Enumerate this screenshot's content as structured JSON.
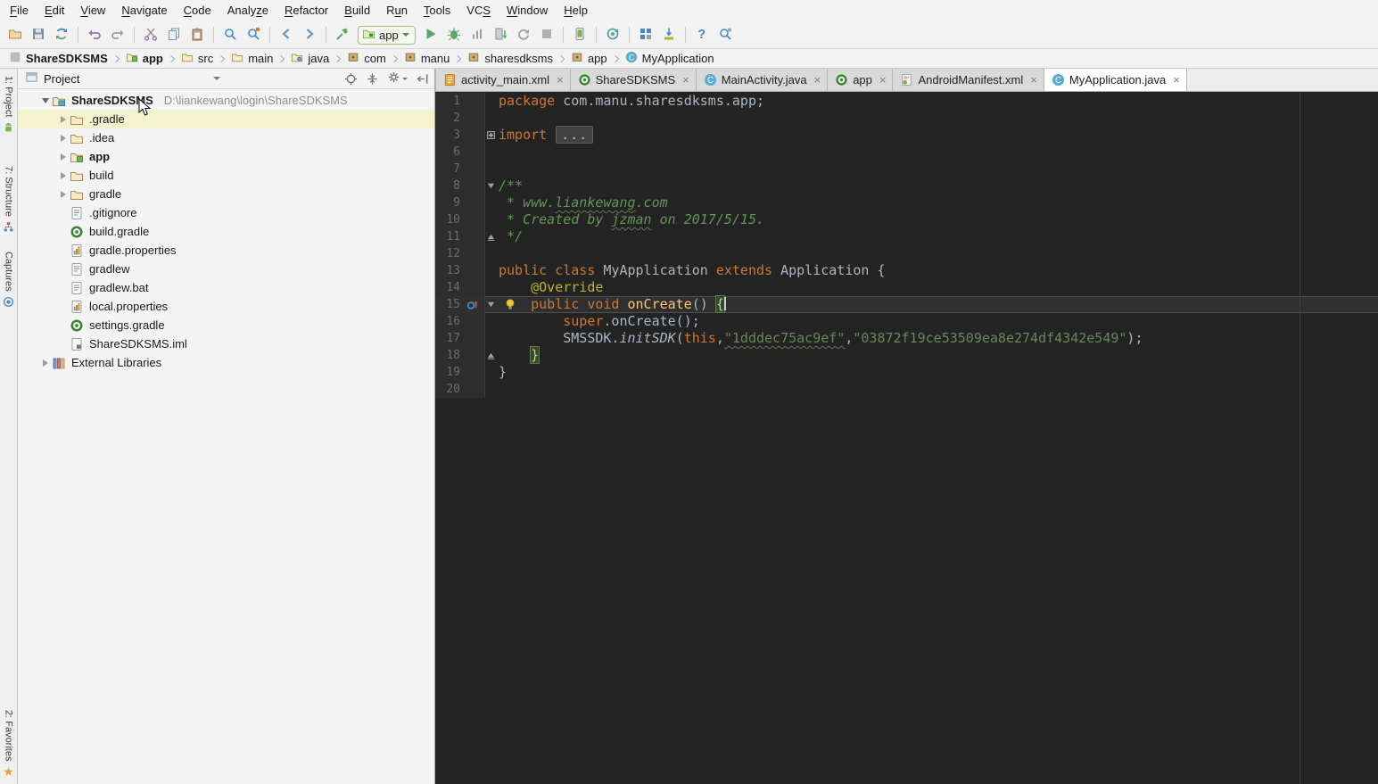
{
  "menu_bar": {
    "items": [
      {
        "label": "File",
        "mnemonic": 0
      },
      {
        "label": "Edit",
        "mnemonic": 0
      },
      {
        "label": "View",
        "mnemonic": 0
      },
      {
        "label": "Navigate",
        "mnemonic": 0
      },
      {
        "label": "Code",
        "mnemonic": 0
      },
      {
        "label": "Analyze",
        "mnemonic": 5
      },
      {
        "label": "Refactor",
        "mnemonic": 0
      },
      {
        "label": "Build",
        "mnemonic": 0
      },
      {
        "label": "Run",
        "mnemonic": 1
      },
      {
        "label": "Tools",
        "mnemonic": 0
      },
      {
        "label": "VCS",
        "mnemonic": 2
      },
      {
        "label": "Window",
        "mnemonic": 0
      },
      {
        "label": "Help",
        "mnemonic": 0
      }
    ]
  },
  "toolbar": {
    "run_config": {
      "label": "app"
    },
    "sections": [
      {
        "icons": [
          "open-icon",
          "save-icon",
          "sync-icon"
        ]
      },
      {
        "sep": true,
        "icons": [
          "undo-icon",
          "redo-icon"
        ]
      },
      {
        "sep": true,
        "icons": [
          "cut-icon",
          "copy-icon",
          "paste-icon"
        ]
      },
      {
        "sep": true,
        "icons": [
          "find-icon",
          "replace-icon"
        ]
      },
      {
        "sep": true,
        "icons": [
          "back-icon",
          "forward-icon"
        ]
      },
      {
        "sep": true,
        "icons": [
          "build-icon"
        ]
      },
      {
        "combo": true
      },
      {
        "icons": [
          "run-icon",
          "debug-icon",
          "coverage-icon",
          "attach-icon",
          "rerun-icon",
          "stop-icon"
        ]
      },
      {
        "sep": true,
        "icons": [
          "avd-manager-icon"
        ]
      },
      {
        "sep": true,
        "icons": [
          "gradle-sync-icon"
        ]
      },
      {
        "sep": true,
        "icons": [
          "project-structure-icon",
          "sdk-manager-icon"
        ]
      },
      {
        "sep": true,
        "icons": [
          "help-icon",
          "search-settings-icon"
        ]
      }
    ]
  },
  "breadcrumbs": [
    {
      "label": "ShareSDKSMS",
      "icon": "module-folder-icon",
      "bold": true
    },
    {
      "label": "app",
      "icon": "android-module-icon",
      "bold": true
    },
    {
      "label": "src",
      "icon": "folder-icon"
    },
    {
      "label": "main",
      "icon": "folder-icon"
    },
    {
      "label": "java",
      "icon": "src-folder-icon"
    },
    {
      "label": "com",
      "icon": "package-icon"
    },
    {
      "label": "manu",
      "icon": "package-icon"
    },
    {
      "label": "sharesdksms",
      "icon": "package-icon"
    },
    {
      "label": "app",
      "icon": "package-icon"
    },
    {
      "label": "MyApplication",
      "icon": "class-icon"
    }
  ],
  "stripe_left": {
    "top": [
      {
        "label": "1: Project",
        "icon": "android-icon",
        "cls": "sb-project"
      },
      {
        "label": "7: Structure",
        "icon": "structure-icon",
        "cls": "sb-structure"
      },
      {
        "label": "Captures",
        "icon": "captures-icon",
        "cls": "sb-captures"
      }
    ],
    "bottom": [
      {
        "label": "2: Favorites",
        "icon": "star-icon",
        "cls": "sb-favorites"
      }
    ]
  },
  "project_panel": {
    "header": {
      "title": "Project",
      "icons": [
        "panel-icon"
      ],
      "right_icons": [
        "locate-icon",
        "collapse-all-icon",
        "gear-icon",
        "hide-panel-icon"
      ]
    },
    "tree": [
      {
        "label": "ShareSDKSMS",
        "path": "D:\\liankewang\\login\\ShareSDKSMS",
        "icon": "project-folder-icon",
        "bold": true,
        "level": 0,
        "arrow": "expanded"
      },
      {
        "label": ".gradle",
        "icon": "folder-icon",
        "level": 1,
        "arrow": "collapsed",
        "hovered": true
      },
      {
        "label": ".idea",
        "icon": "folder-icon",
        "level": 1,
        "arrow": "collapsed"
      },
      {
        "label": "app",
        "icon": "android-module-icon",
        "bold": true,
        "level": 1,
        "arrow": "collapsed"
      },
      {
        "label": "build",
        "icon": "folder-icon",
        "level": 1,
        "arrow": "collapsed"
      },
      {
        "label": "gradle",
        "icon": "folder-icon",
        "level": 1,
        "arrow": "collapsed"
      },
      {
        "label": ".gitignore",
        "icon": "text-file-icon",
        "level": 1
      },
      {
        "label": "build.gradle",
        "icon": "gradle-file-icon",
        "level": 1
      },
      {
        "label": "gradle.properties",
        "icon": "properties-file-icon",
        "level": 1
      },
      {
        "label": "gradlew",
        "icon": "text-file-icon",
        "level": 1
      },
      {
        "label": "gradlew.bat",
        "icon": "text-file-icon",
        "level": 1
      },
      {
        "label": "local.properties",
        "icon": "properties-file-icon",
        "level": 1
      },
      {
        "label": "settings.gradle",
        "icon": "gradle-file-icon",
        "level": 1
      },
      {
        "label": "ShareSDKSMS.iml",
        "icon": "iml-file-icon",
        "level": 1
      },
      {
        "label": "External Libraries",
        "icon": "libraries-icon",
        "level": 0,
        "arrow": "collapsed"
      }
    ]
  },
  "editor": {
    "tabs": [
      {
        "label": "activity_main.xml",
        "icon": "layout-xml-icon",
        "close": "×"
      },
      {
        "label": "ShareSDKSMS",
        "icon": "gradle-file-icon",
        "close": "×"
      },
      {
        "label": "MainActivity.java",
        "icon": "class-icon",
        "close": "×"
      },
      {
        "label": "app",
        "icon": "gradle-file-icon",
        "close": "×"
      },
      {
        "label": "AndroidManifest.xml",
        "icon": "manifest-xml-icon",
        "close": "×"
      },
      {
        "label": "MyApplication.java",
        "icon": "class-icon",
        "close": "×",
        "active": true
      }
    ],
    "lines": [
      {
        "n": "1",
        "t": [
          [
            "kw",
            "package"
          ],
          [
            "pl",
            " com.manu.sharesdksms.app;"
          ]
        ]
      },
      {
        "n": "2",
        "t": []
      },
      {
        "n": "3",
        "fold": "plus",
        "t": [
          [
            "kw",
            "import"
          ],
          [
            "fb",
            "..."
          ]
        ]
      },
      {
        "n": "6",
        "t": []
      },
      {
        "n": "7",
        "t": []
      },
      {
        "n": "8",
        "fold": "down",
        "t": [
          [
            "cm",
            "/**"
          ]
        ]
      },
      {
        "n": "9",
        "t": [
          [
            "cm",
            " * www."
          ],
          [
            "cm typo",
            "liankewang"
          ],
          [
            "cm",
            ".com"
          ]
        ]
      },
      {
        "n": "10",
        "t": [
          [
            "cm",
            " * Created by "
          ],
          [
            "cm typo",
            "jzman"
          ],
          [
            "cm",
            " on 2017/5/15."
          ]
        ]
      },
      {
        "n": "11",
        "fold": "up",
        "t": [
          [
            "cm",
            " */"
          ]
        ]
      },
      {
        "n": "12",
        "t": []
      },
      {
        "n": "13",
        "t": [
          [
            "kw",
            "public class"
          ],
          [
            "pl",
            " MyApplication "
          ],
          [
            "kw",
            "extends"
          ],
          [
            "pl",
            " Application {"
          ]
        ]
      },
      {
        "n": "14",
        "t": [
          [
            "pl",
            "    "
          ],
          [
            "an",
            "@Override"
          ]
        ]
      },
      {
        "n": "15",
        "current": true,
        "fold": "down",
        "gutter_icon": "override-icon",
        "bulb": true,
        "caret": true,
        "t": [
          [
            "pl",
            "    "
          ],
          [
            "kw",
            "public void"
          ],
          [
            "pl",
            " "
          ],
          [
            "md",
            "onCreate"
          ],
          [
            "pl",
            "() "
          ],
          [
            "br",
            "{"
          ]
        ]
      },
      {
        "n": "16",
        "t": [
          [
            "pl",
            "        "
          ],
          [
            "kw",
            "super"
          ],
          [
            "pl",
            ".onCreate();"
          ]
        ]
      },
      {
        "n": "17",
        "t": [
          [
            "pl",
            "        SMSSDK."
          ],
          [
            "sm",
            "initSDK"
          ],
          [
            "pl",
            "("
          ],
          [
            "kw",
            "this"
          ],
          [
            "pl",
            ","
          ],
          [
            "st typo",
            "\"1dddec75ac9ef\""
          ],
          [
            "pl",
            ","
          ],
          [
            "st",
            "\"03872f19ce53509ea8e274df4342e549\""
          ],
          [
            "pl",
            ");"
          ]
        ]
      },
      {
        "n": "18",
        "fold": "up",
        "t": [
          [
            "pl",
            "    "
          ],
          [
            "br",
            "}"
          ]
        ]
      },
      {
        "n": "19",
        "t": [
          [
            "pl",
            "}"
          ]
        ]
      },
      {
        "n": "20",
        "t": []
      }
    ]
  },
  "colors": {
    "editor_bg": "#232323",
    "gutter_bg": "#2D2D2D",
    "keyword": "#CC7832",
    "string": "#6A8759",
    "comment": "#629755",
    "annotation": "#BBB529",
    "method_decl": "#FFC66D",
    "plain": "#A9B7C6",
    "line_number": "#6A6D70",
    "caret_row": "#2F2F2F",
    "panel_bg": "#F4F4F4",
    "hover_row": "#F5F2CF",
    "run_green": "#59A869",
    "folder_tan": "#B08A50"
  }
}
